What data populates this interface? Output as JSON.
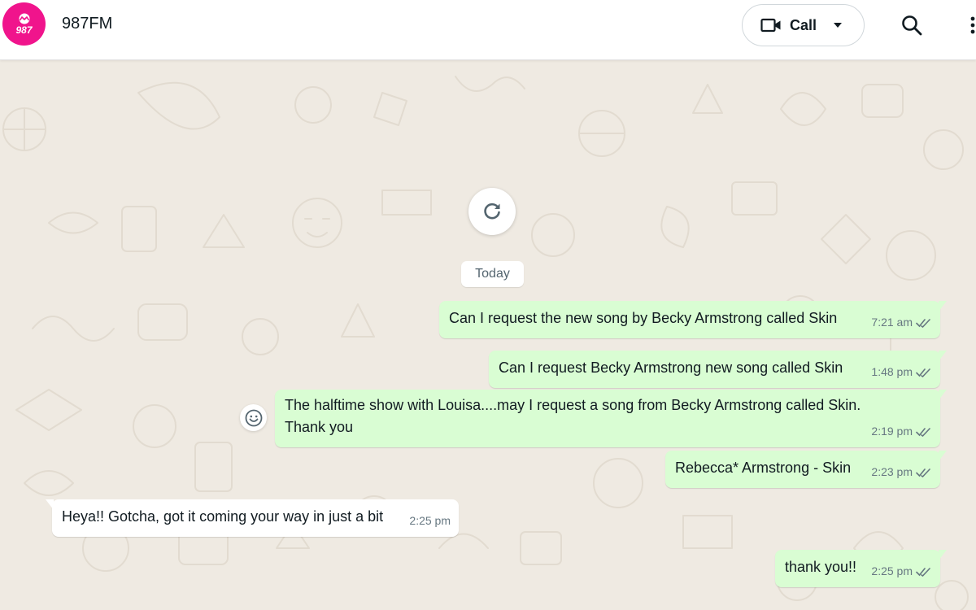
{
  "header": {
    "contact_name": "987FM",
    "avatar_text": "987",
    "call_label": "Call",
    "brand_color": "#f0148c"
  },
  "chat": {
    "date_label": "Today",
    "messages": [
      {
        "direction": "outgoing",
        "text": "Can I request the new song by Becky Armstrong called  Skin",
        "time": "7:21 am",
        "status": "read"
      },
      {
        "direction": "outgoing",
        "text": "Can I request Becky Armstrong new song called Skin",
        "time": "1:48 pm",
        "status": "read"
      },
      {
        "direction": "outgoing",
        "text_line1": "The halftime show with Louisa....may I request a song from Becky Armstrong called Skin.",
        "text_line2": "Thank you",
        "time": "2:19 pm",
        "status": "read"
      },
      {
        "direction": "outgoing",
        "text": "Rebecca* Armstrong - Skin",
        "time": "2:23 pm",
        "status": "read"
      },
      {
        "direction": "incoming",
        "text": "Heya!! Gotcha, got it coming your way in just a bit",
        "time": "2:25 pm"
      },
      {
        "direction": "outgoing",
        "text": "thank you!!",
        "time": "2:25 pm",
        "status": "read"
      }
    ],
    "outgoing_bubble_color": "#d9fdd3",
    "incoming_bubble_color": "#ffffff",
    "background_color": "#efeae2"
  },
  "icons": {
    "call": "video-camera-icon",
    "call_menu": "caret-down-icon",
    "search": "search-icon",
    "menu": "vertical-dots-icon",
    "refresh": "refresh-icon",
    "emoji": "smiley-icon",
    "ticks": "double-check-icon"
  }
}
